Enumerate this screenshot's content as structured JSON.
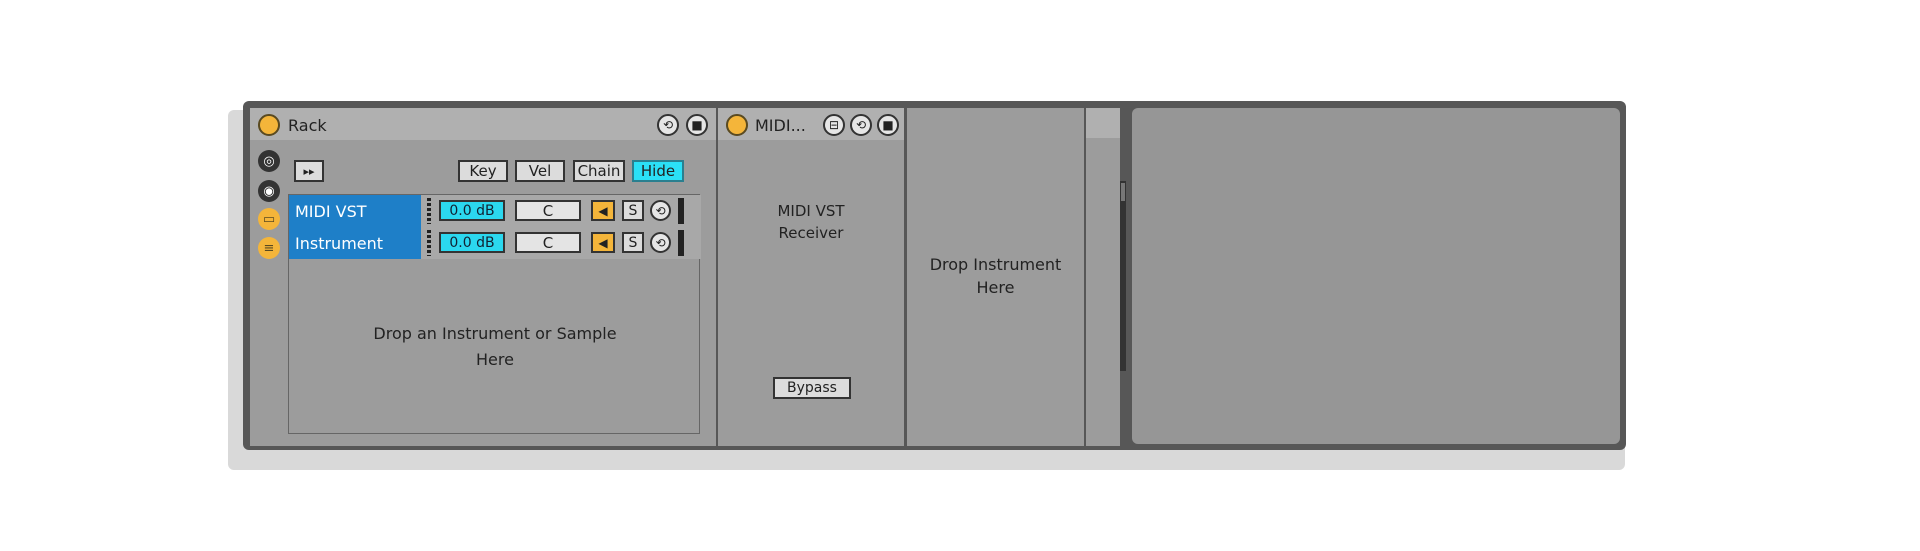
{
  "rack": {
    "title": "Rack",
    "buttons": {
      "key": "Key",
      "vel": "Vel",
      "chain": "Chain",
      "hide": "Hide"
    },
    "chains": [
      {
        "name": "MIDI VST",
        "volume": "0.0 dB",
        "pan": "C",
        "solo": "S"
      },
      {
        "name": "Instrument",
        "volume": "0.0 dB",
        "pan": "C",
        "solo": "S"
      }
    ],
    "drop_line1": "Drop an Instrument or Sample",
    "drop_line2": "Here"
  },
  "midi_device": {
    "title": "MIDI...",
    "label_line1": "MIDI VST",
    "label_line2": "Receiver",
    "bypass_label": "Bypass"
  },
  "drop_instrument": {
    "line1": "Drop Instrument",
    "line2": "Here"
  },
  "colors": {
    "power": "#f4b53a",
    "chain_selected": "#1e7fc8",
    "accent_cyan": "#2be0f6"
  }
}
